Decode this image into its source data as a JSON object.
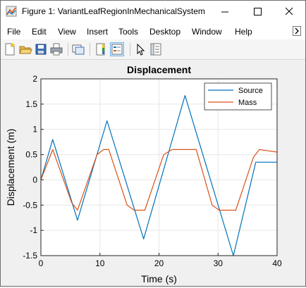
{
  "window": {
    "title": "Figure 1: VariantLeafRegionInMechanicalSystem"
  },
  "menu": {
    "items": [
      "File",
      "Edit",
      "View",
      "Insert",
      "Tools",
      "Desktop",
      "Window",
      "Help"
    ]
  },
  "toolbar": {
    "icons": [
      "new-figure-icon",
      "open-file-icon",
      "save-icon",
      "print-icon",
      "link-plot-icon",
      "insert-colorbar-icon",
      "insert-legend-icon",
      "edit-plot-arrow-icon",
      "property-inspector-icon"
    ]
  },
  "chart_data": {
    "type": "line",
    "title": "Displacement",
    "xlabel": "Time (s)",
    "ylabel": "Displacement (m)",
    "xlim": [
      0,
      40
    ],
    "ylim": [
      -1.5,
      2
    ],
    "xticks": [
      "0",
      "10",
      "20",
      "30",
      "40"
    ],
    "yticks": [
      "-1.5",
      "-1",
      "-0.5",
      "0",
      "0.5",
      "1",
      "1.5",
      "2"
    ],
    "grid": true,
    "legend_position": "top-right",
    "series": [
      {
        "name": "Source",
        "color": "#0072bd",
        "x": [
          0,
          2,
          6.2,
          11.2,
          17.4,
          24.4,
          32.6,
          36.4,
          40
        ],
        "y": [
          0,
          0.8,
          -0.8,
          1.17,
          -1.17,
          1.67,
          -1.5,
          0.35,
          0.35
        ]
      },
      {
        "name": "Mass",
        "color": "#d95319",
        "x": [
          0,
          2,
          5.2,
          6.2,
          9.5,
          10.6,
          11.5,
          14.6,
          15.8,
          17.6,
          20.8,
          22.2,
          26.3,
          29,
          30.2,
          33,
          36,
          37,
          40
        ],
        "y": [
          0,
          0.6,
          -0.45,
          -0.6,
          0.5,
          0.6,
          0.6,
          -0.5,
          -0.6,
          -0.6,
          0.5,
          0.6,
          0.6,
          -0.5,
          -0.6,
          -0.6,
          0.45,
          0.6,
          0.55
        ]
      }
    ]
  }
}
